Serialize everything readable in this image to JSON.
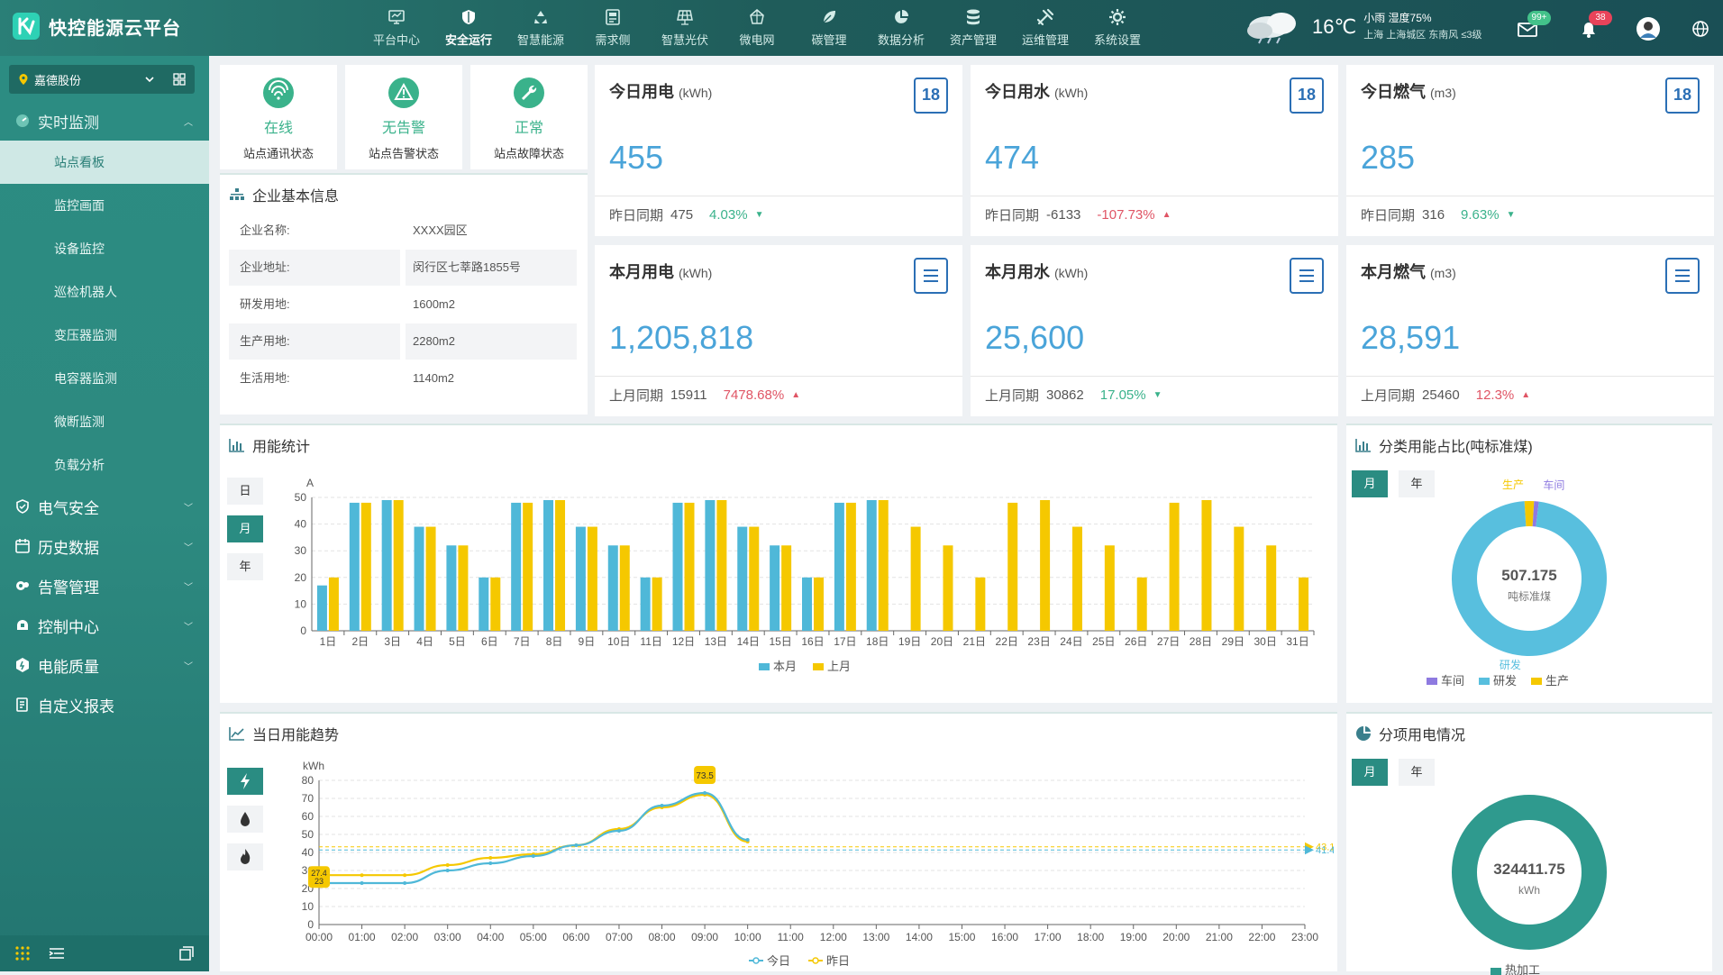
{
  "app": {
    "title": "快控能源云平台"
  },
  "nav": [
    {
      "label": "平台中心",
      "icon": "monitor-icon"
    },
    {
      "label": "安全运行",
      "icon": "shield-icon",
      "active": true
    },
    {
      "label": "智慧能源",
      "icon": "recycle-icon"
    },
    {
      "label": "需求侧",
      "icon": "meter-icon"
    },
    {
      "label": "智慧光伏",
      "icon": "solar-panel-icon"
    },
    {
      "label": "微电网",
      "icon": "grid-icon"
    },
    {
      "label": "碳管理",
      "icon": "leaf-icon"
    },
    {
      "label": "数据分析",
      "icon": "pie-icon"
    },
    {
      "label": "资产管理",
      "icon": "database-icon"
    },
    {
      "label": "运维管理",
      "icon": "tools-icon"
    },
    {
      "label": "系统设置",
      "icon": "gear-icon"
    }
  ],
  "weather": {
    "temp": "16℃",
    "desc": "小雨 湿度75%",
    "location": "上海 上海城区 东南风 ≤3级"
  },
  "badges": {
    "mail": "99+",
    "bell": "38"
  },
  "sidebar": {
    "org": "嘉德股份",
    "groups": [
      {
        "label": "实时监测",
        "icon": "gauge-icon",
        "expanded": true
      },
      {
        "label": "电气安全",
        "icon": "shield-icon"
      },
      {
        "label": "历史数据",
        "icon": "calendar-icon"
      },
      {
        "label": "告警管理",
        "icon": "alarm-icon"
      },
      {
        "label": "控制中心",
        "icon": "control-icon"
      },
      {
        "label": "电能质量",
        "icon": "quality-icon"
      },
      {
        "label": "自定义报表",
        "icon": "report-icon"
      }
    ],
    "sub_items": [
      "站点看板",
      "监控画面",
      "设备监控",
      "巡检机器人",
      "变压器监测",
      "电容器监测",
      "微断监测",
      "负载分析"
    ]
  },
  "status": [
    {
      "value": "在线",
      "label": "站点通讯状态",
      "icon": "wifi-icon"
    },
    {
      "value": "无告警",
      "label": "站点告警状态",
      "icon": "warning-icon"
    },
    {
      "value": "正常",
      "label": "站点故障状态",
      "icon": "wrench-icon"
    }
  ],
  "company": {
    "title": "企业基本信息",
    "rows": [
      {
        "k": "企业名称:",
        "v": "XXXX园区"
      },
      {
        "k": "企业地址:",
        "v": "闵行区七莘路1855号"
      },
      {
        "k": "研发用地:",
        "v": "1600m2"
      },
      {
        "k": "生产用地:",
        "v": "2280m2"
      },
      {
        "k": "生活用地:",
        "v": "1140m2"
      }
    ]
  },
  "metrics": [
    {
      "title": "今日用电",
      "unit": "(kWh)",
      "value": "455",
      "cmp_label": "昨日同期",
      "cmp_value": "475",
      "pct": "4.03%",
      "dir": "down",
      "cal": "18"
    },
    {
      "title": "今日用水",
      "unit": "(kWh)",
      "value": "474",
      "cmp_label": "昨日同期",
      "cmp_value": "-6133",
      "pct": "-107.73%",
      "dir": "up",
      "cal": "18"
    },
    {
      "title": "今日燃气",
      "unit": "(m3)",
      "value": "285",
      "cmp_label": "昨日同期",
      "cmp_value": "316",
      "pct": "9.63%",
      "dir": "down",
      "cal": "18"
    },
    {
      "title": "本月用电",
      "unit": "(kWh)",
      "value": "1,205,818",
      "cmp_label": "上月同期",
      "cmp_value": "15911",
      "pct": "7478.68%",
      "dir": "up",
      "cal": ""
    },
    {
      "title": "本月用水",
      "unit": "(kWh)",
      "value": "25,600",
      "cmp_label": "上月同期",
      "cmp_value": "30862",
      "pct": "17.05%",
      "dir": "down",
      "cal": ""
    },
    {
      "title": "本月燃气",
      "unit": "(m3)",
      "value": "28,591",
      "cmp_label": "上月同期",
      "cmp_value": "25460",
      "pct": "12.3%",
      "dir": "up",
      "cal": ""
    }
  ],
  "energy_stats": {
    "title": "用能统计",
    "tabs": [
      "日",
      "月",
      "年"
    ],
    "active_tab": "月"
  },
  "category_ratio": {
    "title": "分类用能占比(吨标准煤)",
    "tabs": [
      "月",
      "年"
    ],
    "active_tab": "月",
    "center_value": "507.175",
    "center_unit": "吨标准煤"
  },
  "daily_trend": {
    "title": "当日用能趋势",
    "tabs": [
      "electric-icon",
      "water-icon",
      "fire-icon"
    ]
  },
  "sub_item_power": {
    "title": "分项用电情况",
    "tabs": [
      "月",
      "年"
    ],
    "active_tab": "月",
    "center_value": "324411.75",
    "center_unit": "kWh"
  },
  "chart_data": [
    {
      "type": "bar",
      "ylabel": "A",
      "ylim": [
        0,
        50
      ],
      "yticks": [
        0,
        10,
        20,
        30,
        40,
        50
      ],
      "categories": [
        "1日",
        "2日",
        "3日",
        "4日",
        "5日",
        "6日",
        "7日",
        "8日",
        "9日",
        "10日",
        "11日",
        "12日",
        "13日",
        "14日",
        "15日",
        "16日",
        "17日",
        "18日",
        "19日",
        "20日",
        "21日",
        "22日",
        "23日",
        "24日",
        "25日",
        "26日",
        "27日",
        "28日",
        "29日",
        "30日",
        "31日"
      ],
      "series": [
        {
          "name": "本月",
          "color": "#4fb8d8",
          "values": [
            17,
            48,
            49,
            39,
            32,
            20,
            48,
            49,
            39,
            32,
            20,
            48,
            49,
            39,
            32,
            20,
            48,
            49,
            null,
            null,
            null,
            null,
            null,
            null,
            null,
            null,
            null,
            null,
            null,
            null,
            null
          ]
        },
        {
          "name": "上月",
          "color": "#f5c800",
          "values": [
            20,
            48,
            49,
            39,
            32,
            20,
            48,
            49,
            39,
            32,
            20,
            48,
            49,
            39,
            32,
            20,
            48,
            49,
            39,
            32,
            20,
            48,
            49,
            39,
            32,
            20,
            48,
            49,
            39,
            32,
            20
          ]
        }
      ],
      "legend": "bottom",
      "grid": true
    },
    {
      "type": "pie",
      "donut": true,
      "labels": [
        "生产",
        "车间",
        "研发"
      ],
      "colors": [
        "#f5c800",
        "#8e7ae0",
        "#58bfde"
      ],
      "values": [
        2,
        1,
        97
      ],
      "legend_order": [
        "车间",
        "研发",
        "生产"
      ],
      "center": "507.175"
    },
    {
      "type": "line",
      "ylabel": "kWh",
      "ylim": [
        0,
        80
      ],
      "yticks": [
        0,
        10,
        20,
        30,
        40,
        50,
        60,
        70,
        80
      ],
      "x": [
        "00:00",
        "01:00",
        "02:00",
        "03:00",
        "04:00",
        "05:00",
        "06:00",
        "07:00",
        "08:00",
        "09:00",
        "10:00",
        "11:00",
        "12:00",
        "13:00",
        "14:00",
        "15:00",
        "16:00",
        "17:00",
        "18:00",
        "19:00",
        "20:00",
        "21:00",
        "22:00",
        "23:00"
      ],
      "series": [
        {
          "name": "今日",
          "color": "#4fb8d8",
          "values": [
            23,
            23,
            23,
            30,
            34,
            38,
            44,
            52,
            66,
            73,
            47,
            null,
            null,
            null,
            null,
            null,
            null,
            null,
            null,
            null,
            null,
            null,
            null,
            null
          ],
          "avg": 41.4,
          "min_label": "23",
          "max_label": "73.5"
        },
        {
          "name": "昨日",
          "color": "#f5c800",
          "values": [
            27.4,
            27.4,
            27.4,
            33,
            37,
            39,
            44,
            53,
            65,
            72,
            46,
            null,
            null,
            null,
            null,
            null,
            null,
            null,
            null,
            null,
            null,
            null,
            null,
            null
          ],
          "avg": 43.14,
          "min_label": "27.4",
          "max_label": "73.5"
        }
      ],
      "legend": "bottom",
      "grid": true
    },
    {
      "type": "pie",
      "donut": true,
      "labels": [
        "热加工"
      ],
      "colors": [
        "#2f9a8e"
      ],
      "values": [
        100
      ],
      "center": "324411.75"
    }
  ]
}
